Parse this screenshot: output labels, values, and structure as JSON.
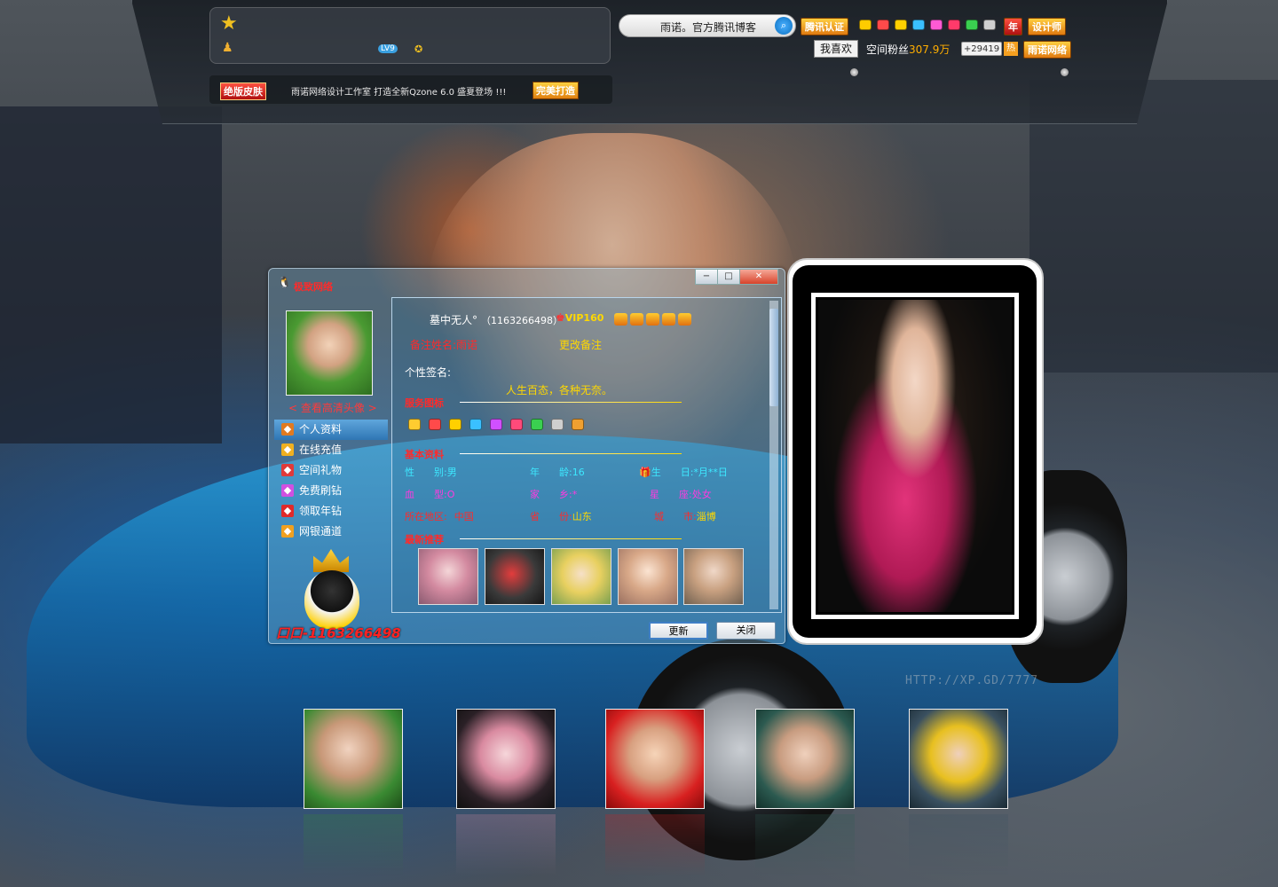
{
  "background": {
    "watermark": "HTTP://XP.GD/7777"
  },
  "header": {
    "star_icon": "star-icon",
    "user_icon": "user-icon",
    "level_badge": "LV9",
    "search_text": "雨诺。官方腾讯博客",
    "certified_tag": "腾讯认证",
    "year_tag": "年",
    "designer_tag": "设计师",
    "like_button": "我喜欢",
    "fans_label": "空间粉丝",
    "fans_count": "307.9万",
    "fans_delta": "+29419",
    "hot_tag": "热",
    "brand_tag": "雨诺网络",
    "announce_badge": "绝版皮肤",
    "announce_text": "雨诺网络设计工作室 打造全新Qzone 6.0 盛夏登场 !!!",
    "announce_tag": "完美打造",
    "gem_colors": [
      "#ffcc00",
      "#ff4a4a",
      "#ffd000",
      "#3ac0ff",
      "#ff5ad4",
      "#ff3a6a",
      "#3ad050",
      "#cfcfcf"
    ]
  },
  "window": {
    "title": "极致网络",
    "controls": {
      "minimize": "−",
      "maximize": "□",
      "close": "✕"
    },
    "view_hd": "< 查看高清头像 >",
    "menu": [
      {
        "label": "个人资料",
        "icon": "profile-icon",
        "color": "#e07a20",
        "active": true
      },
      {
        "label": "在线充值",
        "icon": "dollar-icon",
        "color": "#f0b020",
        "active": false
      },
      {
        "label": "空间礼物",
        "icon": "gift-icon",
        "color": "#e03a3a",
        "active": false
      },
      {
        "label": "免费刷钻",
        "icon": "diamond-icon",
        "color": "#d050e0",
        "active": false
      },
      {
        "label": "领取年钻",
        "icon": "year-icon",
        "color": "#e02a2a",
        "active": false
      },
      {
        "label": "网银通道",
        "icon": "bank-icon",
        "color": "#f0a020",
        "active": false
      }
    ],
    "qq_number": "口口-1163266498",
    "profile": {
      "nickname": "墓中无人°",
      "qq": "（1163266498）",
      "vip": "VIP160",
      "remark_label": "备注姓名:雨诺",
      "remark_link": "更改备注",
      "signature_label": "个性签名:",
      "signature": "人生百态，各种无奈。",
      "service_title": "服务图标",
      "service_icon_colors": [
        "#ffcc30",
        "#ff4a4a",
        "#ffd000",
        "#3ac0ff",
        "#d050ff",
        "#ff4a7a",
        "#3ad050",
        "#cfcfcf",
        "#f0a030"
      ],
      "basic_title": "基本资料",
      "fields": {
        "gender_label": "性　　别:",
        "gender": "男",
        "age_label": "年　　龄:",
        "age": "16",
        "birthday_label": "生　　日:",
        "birthday": "*月**日",
        "blood_label": "血　　型:",
        "blood": "O",
        "home_label": "家　　乡:",
        "home": "*",
        "zodiac_label": "星　　座:",
        "zodiac": "处女",
        "location_label": "所在地区:",
        "location": "中国",
        "province_label": "省　　份:",
        "province": "山东",
        "city_label": "城　　市:",
        "city": "淄博"
      },
      "recommend_title": "最新推荐"
    },
    "refresh_button": "更新",
    "close_button": "关闭"
  }
}
